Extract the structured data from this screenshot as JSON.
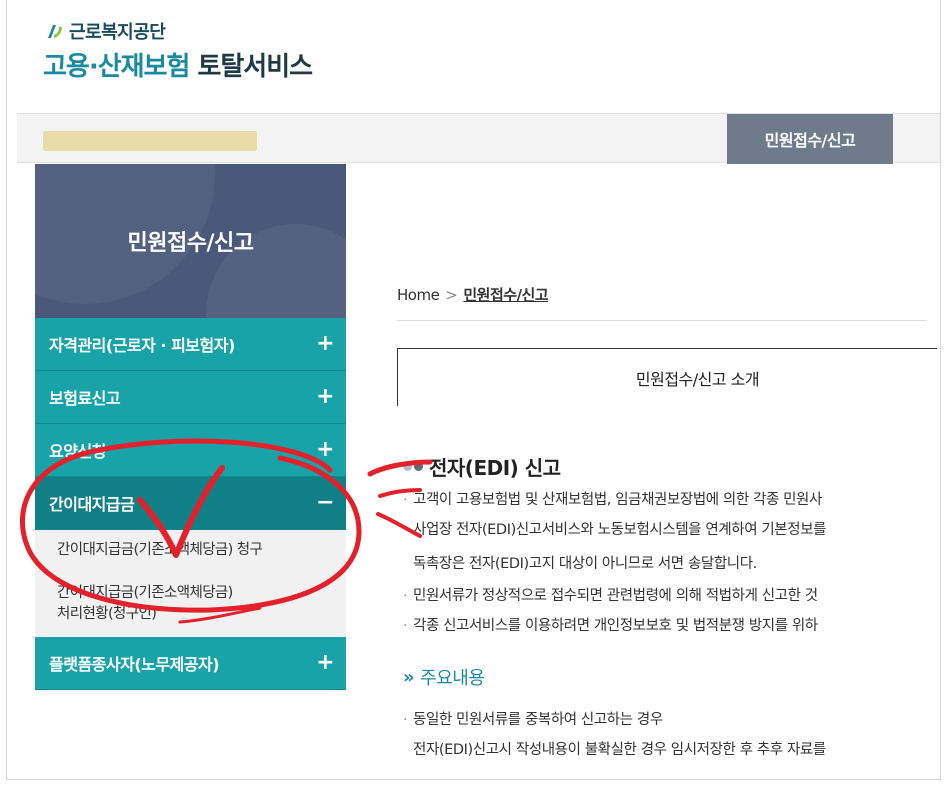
{
  "header": {
    "org_name": "근로복지공단",
    "title_part1": "고용·산재보험",
    "title_part2": "토탈서비스"
  },
  "gnb": {
    "active_label": "민원접수/신고"
  },
  "sidebar": {
    "title": "민원접수/신고",
    "items": [
      {
        "label": "자격관리(근로자 · 피보험자)",
        "sign": "+"
      },
      {
        "label": "보험료신고",
        "sign": "+"
      },
      {
        "label": "요양신청",
        "sign": "+"
      },
      {
        "label": "간이대지급금",
        "sign": "−"
      },
      {
        "label": "플랫폼종사자(노무제공자)",
        "sign": "+"
      }
    ],
    "submenu": [
      {
        "label": "간이대지급금(기존소액체당금) 청구"
      },
      {
        "line1": "간이대지급금(기존소액체당금)",
        "line2": "처리현황(청구인)"
      }
    ]
  },
  "breadcrumb": {
    "home": "Home",
    "sep": ">",
    "current": "민원접수/신고"
  },
  "tab": {
    "label": "민원접수/신고 소개"
  },
  "section": {
    "title": "전자(EDI) 신고",
    "lines": [
      "고객이 고용보험법 및 산재보험법, 임금채권보장법에 의한 각종 민원사",
      "사업장 전자(EDI)신고서비스와 노동보험시스템을 연계하여 기본정보를",
      "독촉장은 전자(EDI)고지 대상이 아니므로 서면 송달합니다.",
      "민원서류가 정상적으로 접수되면 관련법령에 의해 적법하게 신고한 것",
      "각종 신고서비스를 이용하려면 개인정보보호 및 법적분쟁 방지를 위하"
    ]
  },
  "main_content": {
    "heading": "주요내용",
    "lines": [
      "동일한 민원서류를 중복하여 신고하는 경우",
      "전자(EDI)신고시 작성내용이 불확실한 경우 임시저장한 후 추후 자료를"
    ]
  }
}
